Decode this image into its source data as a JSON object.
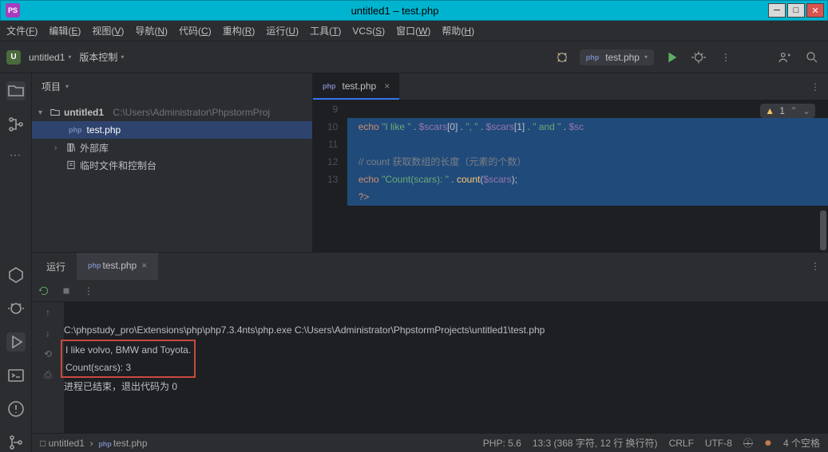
{
  "window": {
    "title": "untitled1 – test.php"
  },
  "menu": [
    "文件(F)",
    "编辑(E)",
    "视图(V)",
    "导航(N)",
    "代码(C)",
    "重构(R)",
    "运行(U)",
    "工具(T)",
    "VCS(S)",
    "窗口(W)",
    "帮助(H)"
  ],
  "menu_keys": [
    "F",
    "E",
    "V",
    "N",
    "C",
    "R",
    "U",
    "T",
    "S",
    "W",
    "H"
  ],
  "nav": {
    "project": "untitled1",
    "vcs": "版本控制",
    "run_config": "test.php"
  },
  "project_panel": {
    "title": "项目",
    "root": "untitled1",
    "root_path": "C:\\Users\\Administrator\\PhpstormProj",
    "file": "test.php",
    "ext_lib": "外部库",
    "scratches": "临时文件和控制台"
  },
  "editor": {
    "tab": "test.php",
    "lines": [
      "9",
      "10",
      "11",
      "12",
      "13"
    ],
    "warn_count": "1",
    "code9_a": "echo",
    "code9_b": "\"I like \"",
    "code9_c": " . ",
    "code9_d": "$scars",
    "code9_e": "[0] . ",
    "code9_f": "\", \"",
    "code9_g": " . ",
    "code9_h": "$scars",
    "code9_i": "[1] . ",
    "code9_j": "\" and \"",
    "code9_k": " . ",
    "code9_l": "$sc",
    "code11": "// count 获取数组的长度（元素的个数）",
    "code12_a": "echo",
    "code12_b": " ",
    "code12_c": "\"Count(scars): \"",
    "code12_d": " . ",
    "code12_e": "count",
    "code12_f": "(",
    "code12_g": "$scars",
    "code12_h": ");",
    "code13": "?>"
  },
  "run": {
    "label": "运行",
    "tab": "test.php",
    "cmd": "C:\\phpstudy_pro\\Extensions\\php\\php7.3.4nts\\php.exe C:\\Users\\Administrator\\PhpstormProjects\\untitled1\\test.php",
    "out1": "I like volvo, BMW and Toyota.",
    "out2": "Count(scars): 3",
    "exit": "进程已结束，退出代码为 0"
  },
  "breadcrumb": {
    "project": "untitled1",
    "file": "test.php"
  },
  "status": {
    "php": "PHP: 5.6",
    "pos": "13:3 (368 字符, 12 行 换行符)",
    "eol": "CRLF",
    "enc": "UTF-8",
    "spaces": "4 个空格"
  }
}
